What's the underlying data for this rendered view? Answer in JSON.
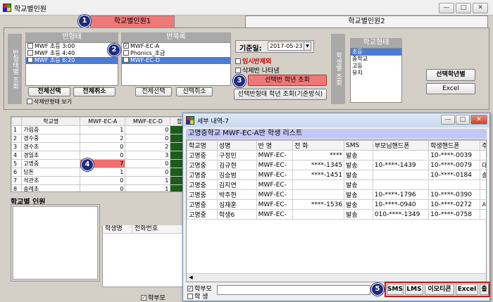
{
  "window": {
    "title": "학교별인원",
    "min_label": "—",
    "max_label": "□",
    "close_label": "✕"
  },
  "tabs": [
    {
      "label": "학교별인원1"
    },
    {
      "label": "학교별인원2"
    }
  ],
  "markers": [
    "1",
    "2",
    "3",
    "4",
    "5"
  ],
  "side_labels": {
    "left": "반형태별 조회",
    "right": "학생별 조회"
  },
  "ban_type": {
    "header": "반형태",
    "items": [
      {
        "label": "MWF 초등 3:00",
        "checked": false
      },
      {
        "label": "MWF 초등 4:40",
        "checked": false
      },
      {
        "label": "MWF 초등 6:20",
        "checked": true
      }
    ],
    "select_all": "전체선택",
    "deselect_all": "전체취소",
    "show_deleted": "삭제반형태 보기"
  },
  "ban_list": {
    "header": "반목록",
    "items": [
      {
        "label": "MWF-EC-A",
        "checked": true
      },
      {
        "label": "Phonics_초급",
        "checked": false
      },
      {
        "label": "MWF-EC-D",
        "checked": true
      }
    ],
    "select_all": "전체선택",
    "deselect_all": "선택취소"
  },
  "date": {
    "label": "기준일:",
    "value": "2017-05-23"
  },
  "options": {
    "exclude_temp": "임시반제외",
    "show_deleted_class": "삭제반 나타냄"
  },
  "query_buttons": {
    "selected_grade": "선택반 학년 조회",
    "grade_by_class": "선택반형태 학년 조회(기준방식)"
  },
  "school_type": {
    "header": "학교형태",
    "items": [
      "초등",
      "중학교",
      "고등",
      "유치"
    ]
  },
  "right_buttons": {
    "selected_grade": "선택학년별",
    "excel": "Excel"
  },
  "school_table": {
    "headers": [
      "",
      "학교명",
      "MWF-EC-A",
      "MWF-EC-D",
      "합 계"
    ],
    "rows": [
      [
        "1",
        "가림중",
        "1",
        "0",
        "1"
      ],
      [
        "2",
        "경수중",
        "2",
        "0",
        "2"
      ],
      [
        "3",
        "경수초",
        "0",
        "2",
        "2"
      ],
      [
        "4",
        "경일초",
        "0",
        "3",
        "3"
      ],
      [
        "5",
        "고명중",
        "7",
        "0",
        "7"
      ],
      [
        "6",
        "담튼",
        "1",
        "0",
        "1"
      ],
      [
        "7",
        "석관초",
        "0",
        "1",
        "1"
      ],
      [
        "8",
        "송례초",
        "0",
        "1",
        "1"
      ]
    ]
  },
  "school_people": {
    "label": "학교별 인원",
    "headers": [
      "학생명",
      "전화번호"
    ],
    "parent_label": "학부모"
  },
  "popup": {
    "title": "세부 내역-7",
    "heading": "고명중학교 MWF-EC-A반 학생 리스트",
    "headers": [
      "학교명",
      "성명",
      "반 명",
      "전 화",
      "SMS",
      "부모님핸드폰",
      "학생핸드폰",
      "주"
    ],
    "rows": [
      [
        "고명중",
        "구정민",
        "MWF-EC-",
        "****",
        "발송",
        "",
        "10-****-0039",
        ""
      ],
      [
        "고명중",
        "김규현",
        "MWF-EC-",
        "****-1345",
        "발송",
        "10-****-1439",
        "10-****-0079",
        "대전"
      ],
      [
        "고명중",
        "김승범",
        "MWF-EC-",
        "****-1451",
        "발송",
        "",
        "10-****-0184",
        "송"
      ],
      [
        "고명중",
        "김지연",
        "MWF-EC-",
        "",
        "발송",
        "",
        "",
        ""
      ],
      [
        "고명중",
        "박주현",
        "MWF-EC-",
        "",
        "발송",
        "10-****-1796",
        "10-****-0390",
        ""
      ],
      [
        "고명중",
        "심재훈",
        "MWF-EC-",
        "****-1536",
        "발송",
        "10-****-0940",
        "10-****-0272",
        "서울"
      ],
      [
        "고명중",
        "학생6",
        "MWF-EC-",
        "",
        "발송",
        "010-****-1349",
        "10-****-0758",
        ""
      ]
    ],
    "footer_checks": [
      {
        "label": "학부모",
        "checked": true
      },
      {
        "label": "학 생",
        "checked": false
      }
    ],
    "buttons": [
      "SMS",
      "LMS",
      "이모티콘",
      "Excel",
      "출"
    ]
  },
  "colors": {
    "accent_red": "#f07070",
    "marker": "#1e2b7c",
    "highlight": "#cc1111"
  }
}
